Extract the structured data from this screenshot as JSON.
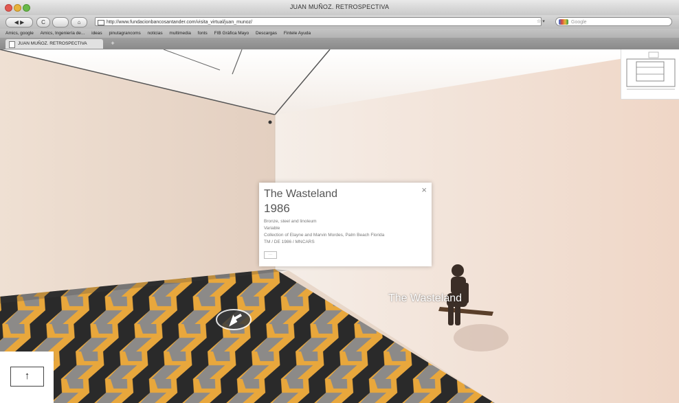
{
  "window": {
    "title": "JUAN MUÑOZ. RETROSPECTIVA",
    "url": "http://www.fundacionbancosantander.com/visita_virtual/juan_munoz/",
    "search_placeholder": "Google",
    "rss_label": "☆ ▾"
  },
  "toolbar": {
    "back_label": "◀ ▶",
    "reload_label": "C",
    "home_label": "⌂"
  },
  "bookmarks": [
    "Amics, google",
    "Amics, Ingeniería de...",
    "ideas",
    "pinutagrancoms",
    "noticias",
    "multimedia",
    "fonts",
    "FIB Gràfica Mayo",
    "Descargas",
    "Fintele Ayuda"
  ],
  "tab": {
    "label": "JUAN MUÑOZ. RETROSPECTIVA",
    "new_tab_label": "+"
  },
  "info_card": {
    "title": "The Wasteland",
    "year": "1986",
    "medium": "Bronze, steel and linoleum",
    "dimensions": "Variable",
    "collection": "Collection of Elayne and Marvin Mordes, Palm Beach Florida",
    "credit": "TM / DE 1986 / MNCARS",
    "close_label": "×",
    "more_label": "···"
  },
  "scene": {
    "sculpture_label": "The Wasteland",
    "up_button_label": "↑",
    "floor_colors": [
      "#e8a73c",
      "#8c8a88",
      "#2a2a2a",
      "#d9d5cf"
    ]
  },
  "icons": {
    "navigate": "navigate-arrow-icon",
    "up": "arrow-up-icon",
    "close": "close-icon"
  }
}
